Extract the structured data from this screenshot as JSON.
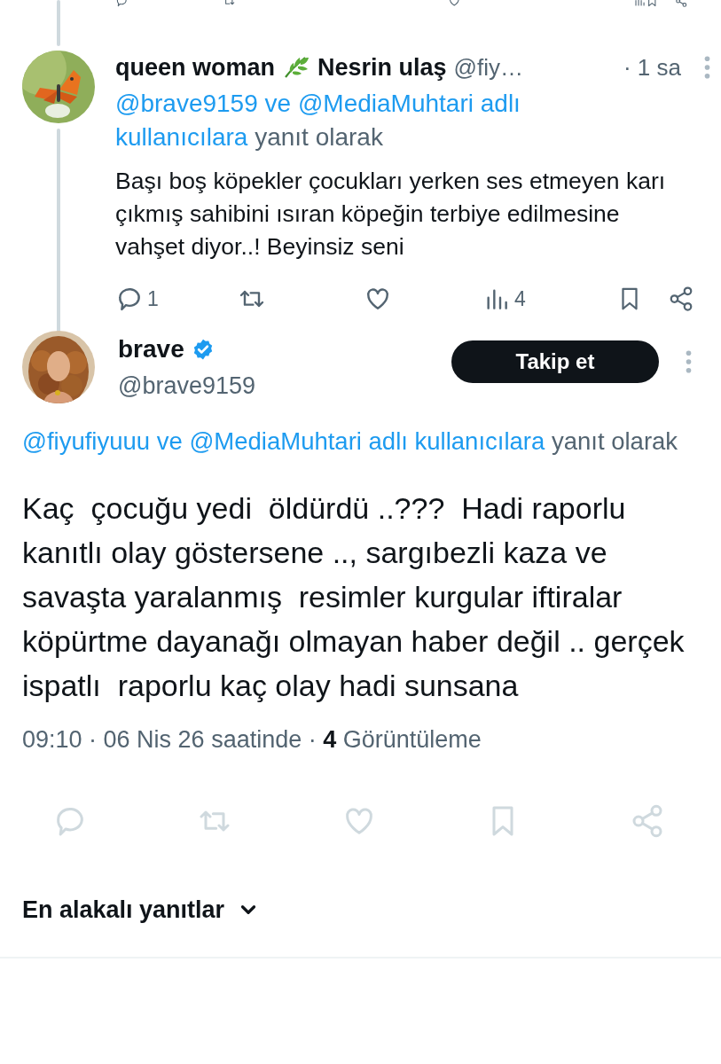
{
  "reply_tweet": {
    "name_first": "queen woman",
    "name_second": "Nesrin ulaş",
    "handle": "@fiy…",
    "time": "· 1 sa",
    "reply_to": [
      {
        "text": "@brave9159",
        "kind": "link"
      },
      {
        "text": "ve",
        "kind": "link"
      },
      {
        "text": "@MediaMuhtari",
        "kind": "link"
      },
      {
        "text": "adlı",
        "kind": "link"
      },
      {
        "text": "kullanıcılara",
        "kind": "link"
      },
      {
        "text": "yanıt olarak",
        "kind": "plain"
      }
    ],
    "text": "Başı boş köpekler çocukları yerken ses etmeyen karı çıkmış sahibini ısıran köpeğin terbiye edilmesine vahşet diyor..! Beyinsiz seni",
    "reply_count": "1",
    "view_count": "4"
  },
  "main_tweet": {
    "name": "brave",
    "verified": true,
    "handle": "@brave9159",
    "follow_button": "Takip et",
    "reply_to": [
      {
        "text": "@fiyufiyuuu",
        "kind": "link"
      },
      {
        "text": "ve",
        "kind": "link"
      },
      {
        "text": "@MediaMuhtari",
        "kind": "link"
      },
      {
        "text": "adlı",
        "kind": "link"
      },
      {
        "text": "kullanıcılara",
        "kind": "link"
      },
      {
        "text": "yanıt",
        "kind": "plain"
      },
      {
        "text": "olarak",
        "kind": "plain"
      }
    ],
    "text": "Kaç  çocuğu yedi  öldürdü ..???  Hadi raporlu kanıtlı olay göstersene .., sargıbezli kaza ve savaşta yaralanmış  resimler kurgular iftiralar köpürtme dayanağı olmayan haber değil .. gerçek ispatlı  raporlu kaç olay hadi sunsana",
    "meta": "09:10 · 06 Nis 26 saatinde · **4** Görüntüleme"
  },
  "replies_sort": {
    "label": "En alakalı yanıtlar"
  }
}
